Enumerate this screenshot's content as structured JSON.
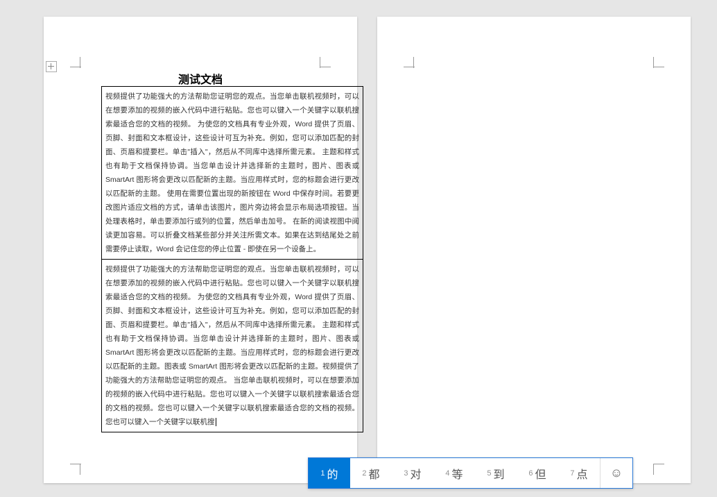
{
  "doc": {
    "title": "测试文档",
    "cell1": "视频提供了功能强大的方法帮助您证明您的观点。当您单击联机视频时，可以在想要添加的视频的嵌入代码中进行粘贴。您也可以键入一个关键字以联机搜索最适合您的文档的视频。\n为使您的文档具有专业外观，Word 提供了页眉、页脚、封面和文本框设计，这些设计可互为补充。例如，您可以添加匹配的封面、页眉和提要栏。单击\"插入\"，然后从不同库中选择所需元素。\n主题和样式也有助于文档保持协调。当您单击设计并选择新的主题时，图片、图表或 SmartArt 图形将会更改以匹配新的主题。当应用样式时，您的标题会进行更改以匹配新的主题。\n使用在需要位置出现的新按钮在 Word 中保存时间。若要更改图片适应文档的方式，请单击该图片，图片旁边将会显示布局选项按钮。当处理表格时，单击要添加行或列的位置，然后单击加号。\n在新的阅读视图中阅读更加容易。可以折叠文档某些部分并关注所需文本。如果在达到结尾处之前需要停止读取，Word 会记住您的停止位置 - 即使在另一个设备上。",
    "cell2a": "视频提供了功能强大的方法帮助您证明您的观点。当您单击联机视频时，可以在想要添加的视频的嵌入代码中进行粘贴。您也可以键入一个关键字以联机搜索最适合您的文档的视频。\n为使您的文档具有专业外观，Word 提供了页眉、页脚、封面和文本框设计，这些设计可互为补充。例如，您可以添加匹配的封面、页眉和提要栏。单击\"插入\"，然后从不同库中选择所需元素。\n主题和样式也有助于文档保持协调。当您单击设计并选择新的主题时，图片、图表或 SmartArt 图形将会更改以匹配新的主题。当应用样式时，您的标题会进行更改以匹配新的主题。图表或 SmartArt 图形将会更改以匹配新的主题。视频提供了功能强大的方法帮助您证明您的观点。\n当您单击联机视频时，可以在想要添加的视频的嵌入代码中进行粘贴。您也可以键入一个关键字以联机搜索最适合您的文档的视频。您也可以键入一个关键字以联机搜索最适合您的文档的视频。您也可以键入一个关键字以联机搜"
  },
  "ime": {
    "candidates": [
      {
        "n": "1",
        "t": "的"
      },
      {
        "n": "2",
        "t": "都"
      },
      {
        "n": "3",
        "t": "对"
      },
      {
        "n": "4",
        "t": "等"
      },
      {
        "n": "5",
        "t": "到"
      },
      {
        "n": "6",
        "t": "但"
      },
      {
        "n": "7",
        "t": "点"
      }
    ],
    "emoji": "☺"
  }
}
